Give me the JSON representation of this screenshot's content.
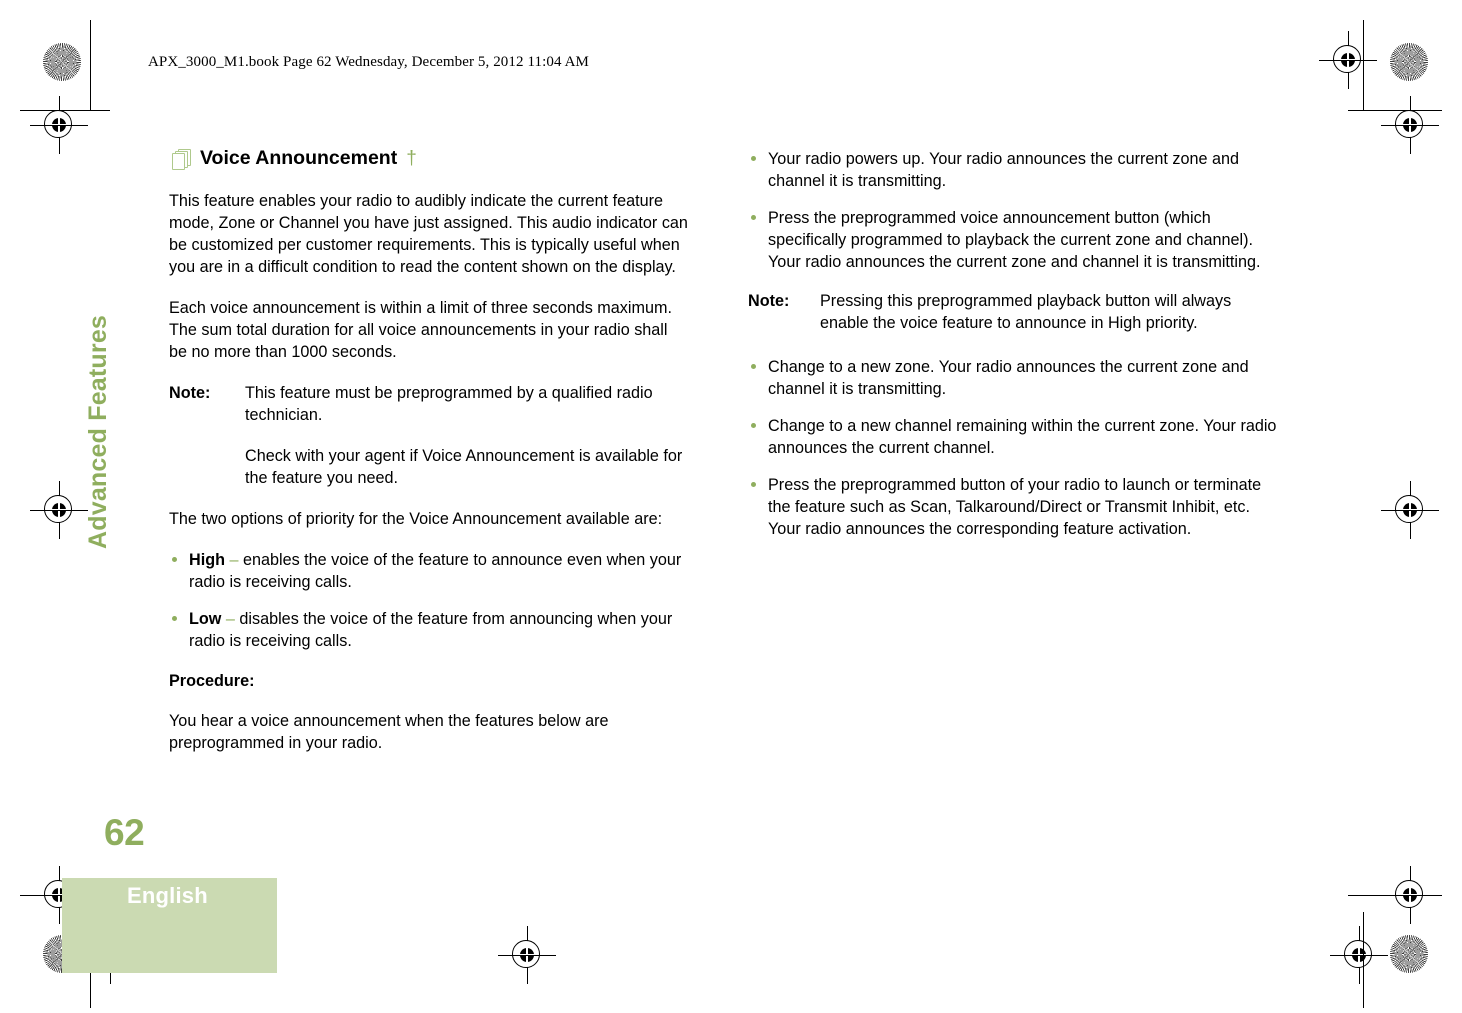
{
  "document": {
    "file_header": "APX_3000_M1.book  Page 62  Wednesday, December 5, 2012  11:04 AM",
    "chapter_tab": "Advanced Features",
    "page_number": "62",
    "language": "English",
    "accent_color": "#8FAE5E",
    "band_color": "#CBDAB2"
  },
  "section": {
    "title": "Voice Announcement",
    "title_marker": "†",
    "icon": "stacked-pages-icon"
  },
  "left_column": {
    "paragraph_1": "This feature enables your radio to audibly indicate the current feature mode, Zone or Channel you have just assigned. This audio indicator can be customized per customer requirements. This is typically useful when you are in a difficult condition to read the content shown on the display.",
    "paragraph_2": "Each voice announcement is within a limit of three seconds maximum. The sum total duration for all voice announcements in your radio shall be no more than 1000 seconds.",
    "note_label": "Note:",
    "note_text": "This feature must be preprogrammed by a qualified radio technician.",
    "note_extra": "Check with your agent if Voice Announcement is available for the feature you need.",
    "paragraph_3": "The two options of priority for the Voice Announcement available are:",
    "priority_options": [
      {
        "term": "High",
        "dash": "–",
        "text": "enables the voice of the feature to announce even when your radio is receiving calls."
      },
      {
        "term": "Low",
        "dash": "–",
        "text": "disables the voice of the feature from announcing when your radio is receiving calls."
      }
    ],
    "procedure_heading": "Procedure:",
    "paragraph_4": "You hear a voice announcement when the features below are preprogrammed in your radio."
  },
  "right_column": {
    "bullets_top": [
      "Your radio powers up. Your radio announces the current zone and channel it is transmitting.",
      "Press the preprogrammed voice announcement button (which specifically programmed to playback the current zone and channel). Your radio announces the current zone and channel it is transmitting."
    ],
    "note_label": "Note:",
    "note_text": "Pressing this preprogrammed playback button will always enable the voice feature to announce in High priority.",
    "bullets_bottom": [
      "Change to a new zone. Your radio announces the current zone and channel it is transmitting.",
      "Change to a new channel remaining within the current zone. Your radio announces the current channel.",
      "Press the preprogrammed button of your radio to launch or terminate the feature such as Scan, Talkaround/Direct or Transmit Inhibit, etc. Your radio announces the corresponding feature activation."
    ]
  }
}
